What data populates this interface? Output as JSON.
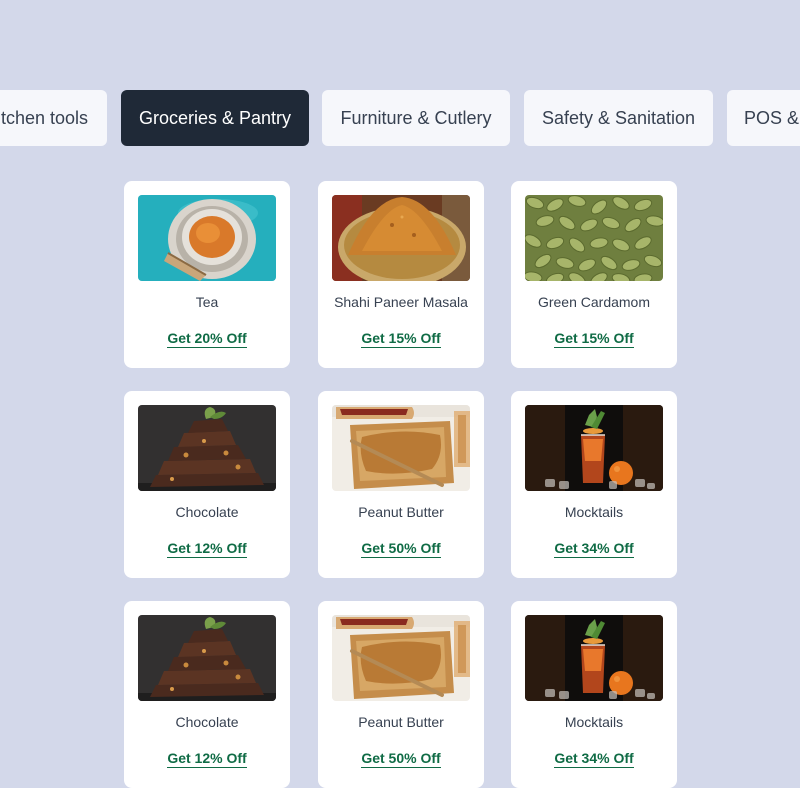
{
  "category_tabs": [
    {
      "label": "Kitchen tools",
      "active": false
    },
    {
      "label": "Groceries & Pantry",
      "active": true
    },
    {
      "label": "Furniture & Cutlery",
      "active": false
    },
    {
      "label": "Safety & Sanitation",
      "active": false
    },
    {
      "label": "POS & Hardware",
      "active": false
    }
  ],
  "products": [
    {
      "name": "Tea",
      "offer": "Get 20% Off",
      "image": "tea-cup-image"
    },
    {
      "name": "Shahi Paneer Masala",
      "offer": "Get 15% Off",
      "image": "spice-powder-bowl-image"
    },
    {
      "name": "Green Cardamom",
      "offer": "Get 15% Off",
      "image": "cardamom-pods-image"
    },
    {
      "name": "Chocolate",
      "offer": "Get 12% Off",
      "image": "chocolate-bark-stack-image"
    },
    {
      "name": "Peanut Butter",
      "offer": "Get 50% Off",
      "image": "peanut-butter-toast-image"
    },
    {
      "name": "Mocktails",
      "offer": "Get 34% Off",
      "image": "mocktail-glass-image"
    },
    {
      "name": "Chocolate",
      "offer": "Get 12% Off",
      "image": "chocolate-bark-stack-image"
    },
    {
      "name": "Peanut Butter",
      "offer": "Get 50% Off",
      "image": "peanut-butter-toast-image"
    },
    {
      "name": "Mocktails",
      "offer": "Get 34% Off",
      "image": "mocktail-glass-image"
    }
  ],
  "colors": {
    "background": "#d3d8ea",
    "tab_active_bg": "#1f2937",
    "tab_bg": "#f6f7fb",
    "offer_link": "#0f6b45"
  }
}
